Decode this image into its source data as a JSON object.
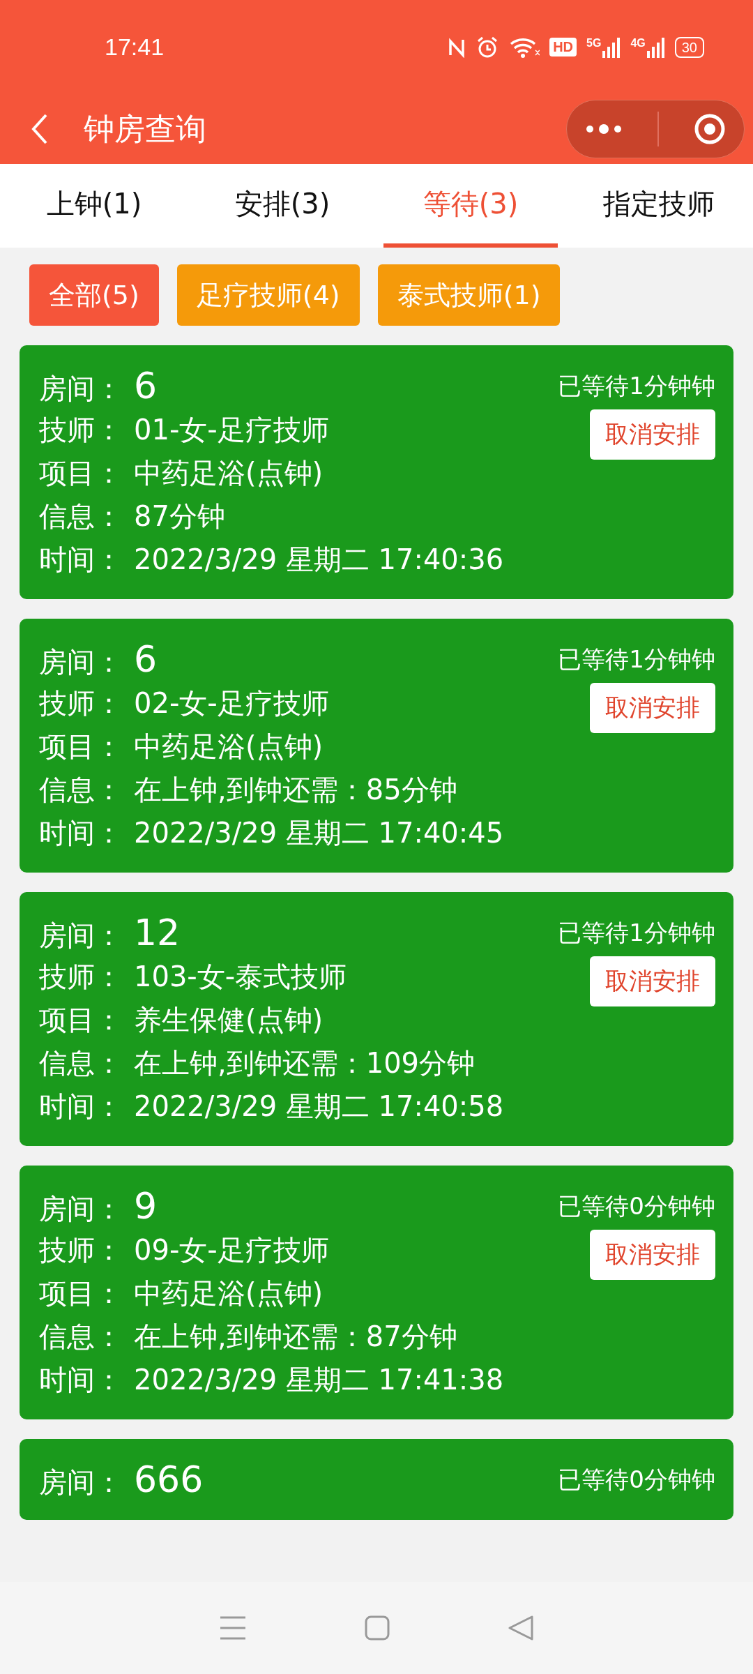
{
  "status_bar": {
    "time": "17:41",
    "hd": "HD",
    "networks": [
      "5G",
      "4G"
    ],
    "battery": "30"
  },
  "header": {
    "title": "钟房查询"
  },
  "tabs": [
    {
      "label": "上钟(1)",
      "selected": false
    },
    {
      "label": "安排(3)",
      "selected": false
    },
    {
      "label": "等待(3)",
      "selected": true
    },
    {
      "label": "指定技师",
      "selected": false
    }
  ],
  "filters": [
    {
      "label": "全部(5)",
      "selected": true
    },
    {
      "label": "足疗技师(4)",
      "selected": false
    },
    {
      "label": "泰式技师(1)",
      "selected": false
    }
  ],
  "cards": [
    {
      "room_label": "房间：",
      "room": "6",
      "wait": "已等待1分钟钟",
      "button": "取消安排",
      "fields": [
        {
          "label": "技师：",
          "value": "01-女-足疗技师"
        },
        {
          "label": "项目：",
          "value": "中药足浴(点钟)"
        },
        {
          "label": "信息：",
          "value": "87分钟"
        },
        {
          "label": "时间：",
          "value": "2022/3/29 星期二 17:40:36"
        }
      ]
    },
    {
      "room_label": "房间：",
      "room": "6",
      "wait": "已等待1分钟钟",
      "button": "取消安排",
      "fields": [
        {
          "label": "技师：",
          "value": "02-女-足疗技师"
        },
        {
          "label": "项目：",
          "value": "中药足浴(点钟)"
        },
        {
          "label": "信息：",
          "value": "在上钟,到钟还需：85分钟"
        },
        {
          "label": "时间：",
          "value": "2022/3/29 星期二 17:40:45"
        }
      ]
    },
    {
      "room_label": "房间：",
      "room": "12",
      "wait": "已等待1分钟钟",
      "button": "取消安排",
      "fields": [
        {
          "label": "技师：",
          "value": "103-女-泰式技师"
        },
        {
          "label": "项目：",
          "value": "养生保健(点钟)"
        },
        {
          "label": "信息：",
          "value": "在上钟,到钟还需：109分钟"
        },
        {
          "label": "时间：",
          "value": "2022/3/29 星期二 17:40:58"
        }
      ]
    },
    {
      "room_label": "房间：",
      "room": "9",
      "wait": "已等待0分钟钟",
      "button": "取消安排",
      "fields": [
        {
          "label": "技师：",
          "value": "09-女-足疗技师"
        },
        {
          "label": "项目：",
          "value": "中药足浴(点钟)"
        },
        {
          "label": "信息：",
          "value": "在上钟,到钟还需：87分钟"
        },
        {
          "label": "时间：",
          "value": "2022/3/29 星期二 17:41:38"
        }
      ]
    },
    {
      "room_label": "房间：",
      "room": "666",
      "wait": "已等待0分钟钟"
    }
  ]
}
